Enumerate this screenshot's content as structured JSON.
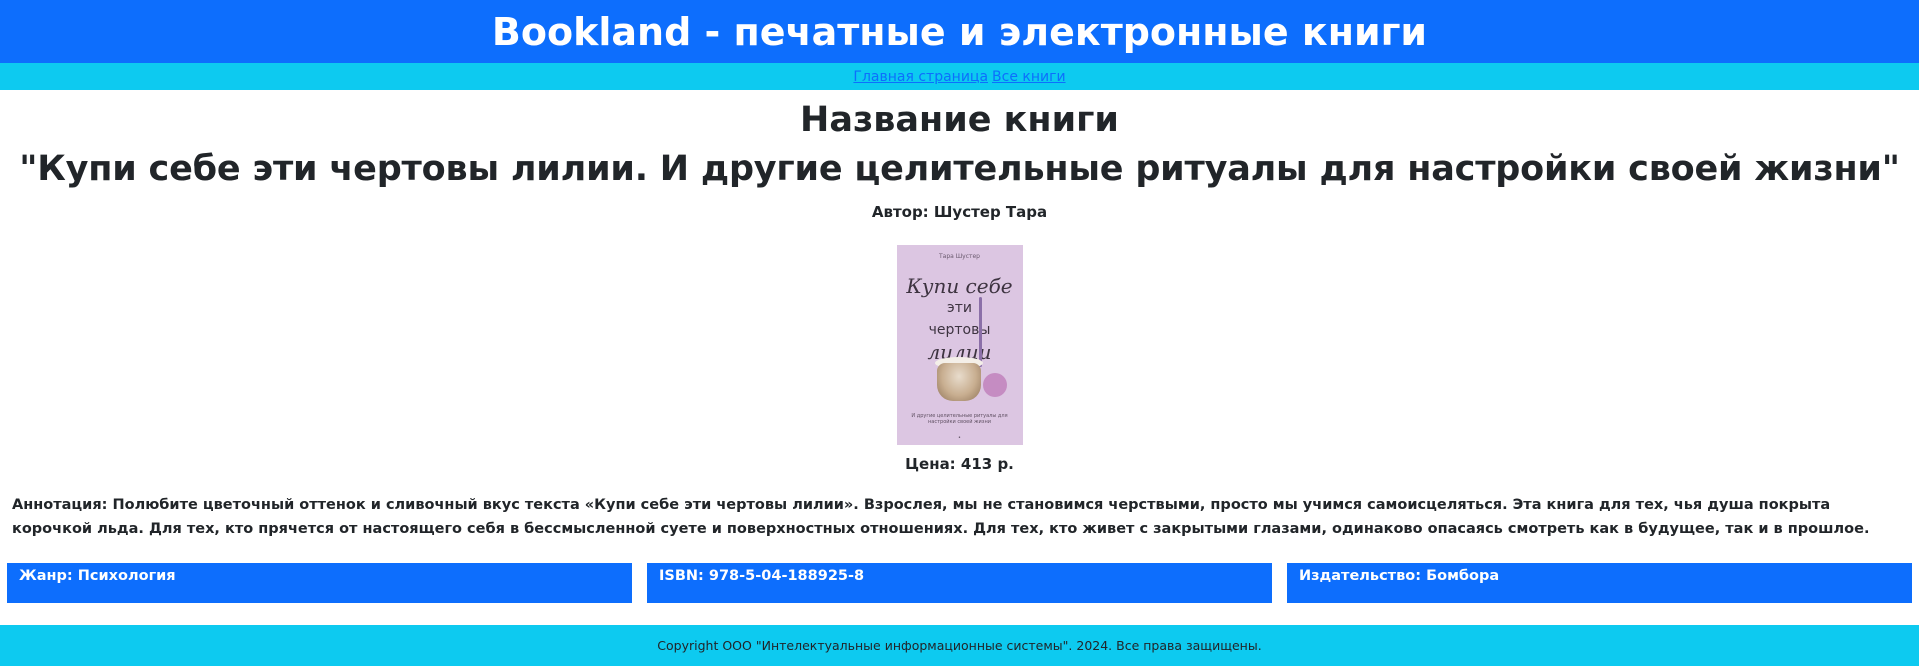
{
  "header": {
    "title": "Bookland - печатные и электронные книги"
  },
  "nav": {
    "home_label": "Главная страница",
    "all_books_label": "Все книги"
  },
  "book": {
    "heading_label": "Название книги",
    "title": "\"Купи себе эти чертовы лилии. И другие целительные ритуалы для настройки своей жизни\"",
    "author_line": "Автор: Шустер Тара",
    "price_line": "Цена: 413 р.",
    "annotation": "Аннотация: Полюбите цветочный оттенок и сливочный вкус текста «Купи себе эти чертовы лилии». Взрослея, мы не становимся черствыми, просто мы учимся самоисцеляться. Эта книга для тех, чья душа покрыта корочкой льда. Для тех, кто прячется от настоящего себя в бессмысленной суете и поверхностных отношениях. Для тех, кто живет с закрытыми глазами, одинаково опасаясь смотреть как в будущее, так и в прошлое.",
    "cover": {
      "author": "Тара Шустер",
      "title_line1": "Купи себе",
      "title_line2": "эти",
      "title_line3": "чертовы",
      "title_line4": "лилии",
      "subtitle": "И другие целительные ритуалы для настройки своей жизни"
    }
  },
  "info": {
    "genre": "Жанр: Психология",
    "isbn": "ISBN: 978-5-04-188925-8",
    "publisher": "Издательство: Бомбора"
  },
  "footer": {
    "copyright": "Copyright ООО \"Интелектуальные информационные системы\". 2024. Все права защищены."
  },
  "colors": {
    "header_bg": "#0d6efd",
    "nav_bg": "#0dcaf0",
    "info_box_bg": "#0d6efd",
    "footer_bg": "#0dcaf0",
    "link": "#0d6efd"
  }
}
